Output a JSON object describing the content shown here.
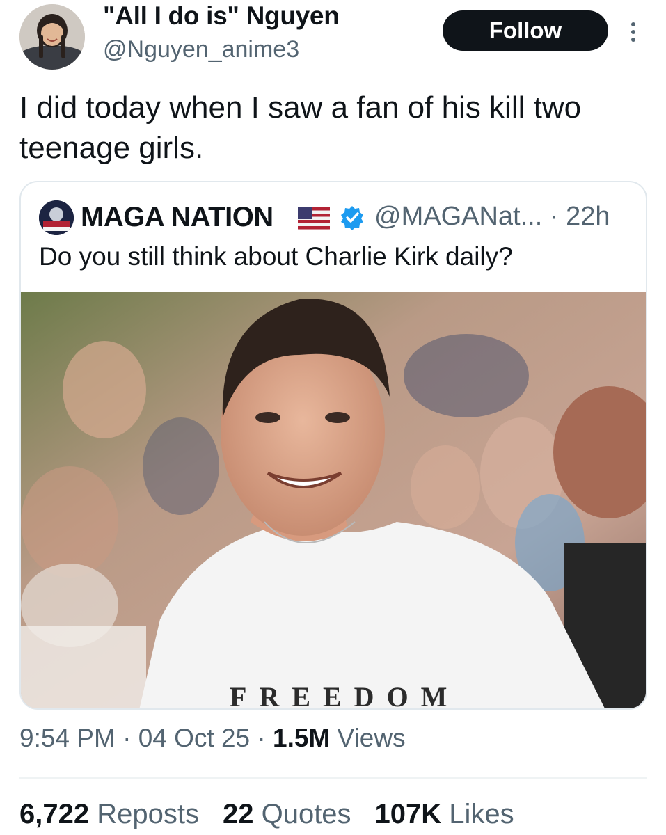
{
  "author": {
    "name": "\"All I do is\" Nguyen",
    "handle": "@Nguyen_anime3"
  },
  "follow_label": "Follow",
  "more_icon": "more-vertical-icon",
  "tweet_text": "I did today when I saw a fan of his kill two teenage girls.",
  "quote": {
    "name": "MAGA NATION",
    "flag_icon": "us-flag-icon",
    "verified_icon": "verified-badge-icon",
    "verified_color": "#1d9bf0",
    "handle": "@MAGANat...",
    "sep": " · ",
    "age": "22h",
    "text": "Do you still think about Charlie Kirk daily?",
    "photo_shirt_text": "FREEDOM"
  },
  "meta": {
    "time": "9:54 PM",
    "sep1": " · ",
    "date": "04 Oct 25",
    "sep2": " · ",
    "views_count": "1.5M",
    "views_label": " Views"
  },
  "stats": {
    "reposts_count": "6,722",
    "reposts_label": " Reposts",
    "quotes_count": "22",
    "quotes_label": " Quotes",
    "likes_count": "107K",
    "likes_label": " Likes"
  },
  "colors": {
    "text_primary": "#0f1419",
    "text_secondary": "#536471",
    "button_bg": "#0f1419",
    "border": "#e1e8ed"
  }
}
